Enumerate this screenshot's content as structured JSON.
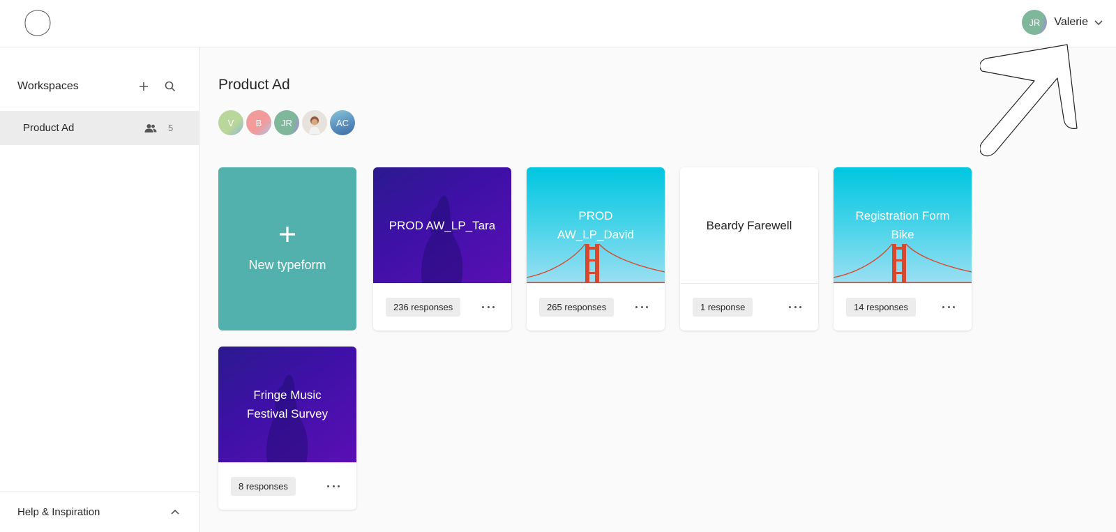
{
  "user": {
    "initials": "JR",
    "name": "Valerie"
  },
  "sidebar": {
    "title": "Workspaces",
    "workspaces": [
      {
        "label": "Product Ad",
        "member_count": "5"
      }
    ],
    "help_label": "Help & Inspiration"
  },
  "main": {
    "title": "Product Ad",
    "members": [
      {
        "initials": "V",
        "color": "#b9d79a"
      },
      {
        "initials": "B",
        "color": "#f29b9b"
      },
      {
        "initials": "JR",
        "color": "#7fb79b"
      },
      {
        "initials": "",
        "kind": "photo"
      },
      {
        "initials": "AC",
        "color": "#5a90c0"
      }
    ],
    "new_typeform_label": "New typeform",
    "forms": [
      {
        "title": "PROD AW_LP_Tara",
        "responses": "236 responses",
        "theme": "purple"
      },
      {
        "title_lines": [
          "PROD",
          "AW_LP_David"
        ],
        "responses": "265 responses",
        "theme": "sky-bridge"
      },
      {
        "title": "Beardy Farewell",
        "responses": "1 response",
        "theme": "white"
      },
      {
        "title_lines": [
          "Registration Form",
          "Bike"
        ],
        "responses": "14 responses",
        "theme": "sky-bridge"
      },
      {
        "title_lines": [
          "Fringe Music",
          "Festival Survey"
        ],
        "responses": "8 responses",
        "theme": "purple"
      }
    ]
  },
  "colors": {
    "accent": "#52b1ad",
    "purple": "#3f10a8",
    "sky": "#00c6e0",
    "bridge": "#d8482c"
  }
}
